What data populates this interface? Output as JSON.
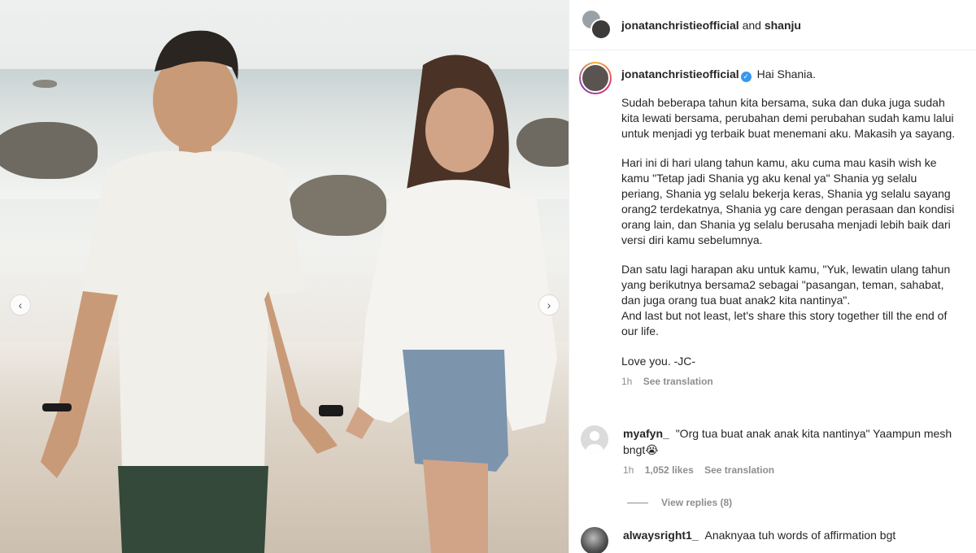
{
  "post": {
    "coauthors": "jonatanchristieofficial",
    "coauthors_and": "and",
    "coauthor2": "shanju"
  },
  "caption": {
    "username": "jonatanchristieofficial",
    "greeting": "Hai Shania.",
    "p1": "Sudah beberapa tahun kita bersama, suka dan duka juga sudah kita lewati bersama, perubahan demi perubahan sudah kamu lalui untuk menjadi yg terbaik buat menemani aku. Makasih ya sayang.",
    "p2": "Hari ini di hari ulang tahun kamu, aku cuma mau kasih wish ke kamu \"Tetap jadi Shania yg aku kenal ya\" Shania yg selalu periang, Shania yg selalu bekerja keras, Shania yg selalu sayang orang2 terdekatnya, Shania yg care dengan perasaan dan kondisi orang lain, dan Shania yg selalu berusaha menjadi lebih baik dari versi diri kamu sebelumnya.",
    "p3": "Dan satu lagi harapan aku untuk kamu, \"Yuk, lewatin ulang tahun yang berikutnya bersama2 sebagai \"pasangan, teman, sahabat, dan juga orang tua buat anak2 kita nantinya\".\nAnd last but not least, let's share this story together till the end of our life.",
    "p4": "Love you. -JC-",
    "time": "1h",
    "see_translation": "See translation"
  },
  "comments": [
    {
      "username": "myafyn_",
      "text": "\"Org tua buat anak anak kita nantinya\" Yaampun mesh bngt😭",
      "time": "1h",
      "likes": "1,052 likes",
      "see_translation": "See translation",
      "view_replies": "View replies (8)"
    },
    {
      "username": "alwaysright1_",
      "text": "Anaknyaa tuh words of affirmation bgt"
    }
  ],
  "icons": {
    "prev": "chevron-left-icon",
    "next": "chevron-right-icon",
    "verified": "verified-badge-icon",
    "like": "heart-icon"
  },
  "colors": {
    "verified": "#3897f0",
    "muted": "#8e8e8e",
    "text": "#262626"
  }
}
